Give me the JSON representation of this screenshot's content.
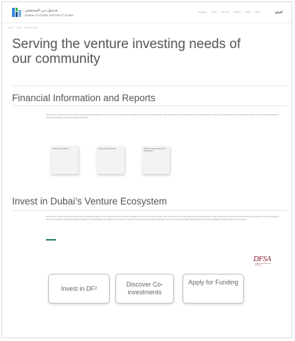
{
  "header": {
    "logo_arabic": "صندوق دبي المستقبلي",
    "logo_english": "DUBAI FUTURE DISTRICT FUND",
    "nav": [
      "Overview",
      "Invest",
      "Partners",
      "Finance",
      "News",
      "About"
    ],
    "language": "عربي"
  },
  "breadcrumb": [
    "Home",
    "Invest",
    "Invest in DF²"
  ],
  "hero": {
    "title": "Serving the venture investing needs of our community"
  },
  "financial": {
    "heading": "Financial Information and Reports",
    "paragraph": "Lorem Ipsum is simply dummy text of the printing and typesetting industry. Lorem Ipsum has been the industry's standard dummy text ever since the 1500s, when an unknown printer took a galley of type and scrambled it to make a type specimen book. It has survived not only five centuries, but also the leap into electronic typesetting, remaining essentially unchanged.",
    "documents": [
      {
        "label": "2021 Annual Report"
      },
      {
        "label": "Q4 Funding Summary"
      },
      {
        "label": "Articles of Association and Prospectus"
      }
    ]
  },
  "invest": {
    "heading": "Invest in Dubai’s Venture Ecosystem",
    "paragraph": "Lorem Ipsum is simply dummy text of the printing and typesetting industry. Lorem Ipsum has been the industry's standard dummy text ever since the 1500s, when an unknown printer took a galley of type and scrambled it to make a type specimen book. It has survived not only five centuries, but also the leap into electronic typesetting, remaining essentially unchanged. It was popularised in the 1960s with the release of Letraset sheets containing Lorem Ipsum passages, and more recently with desktop publishing software like Aldus PageMaker including versions of Lorem Ipsum."
  },
  "regulator": {
    "logo_text": "DFSA",
    "logo_sub": "Dubai Financial Services Authority"
  },
  "actions": {
    "invest_label": "Invest in DF²",
    "discover_label": "Discover Co-investments",
    "apply_label": "Apply for Funding"
  },
  "colors": {
    "accent": "#1f7a5c",
    "regulator_brand": "#8a2231",
    "text": "#555555"
  }
}
